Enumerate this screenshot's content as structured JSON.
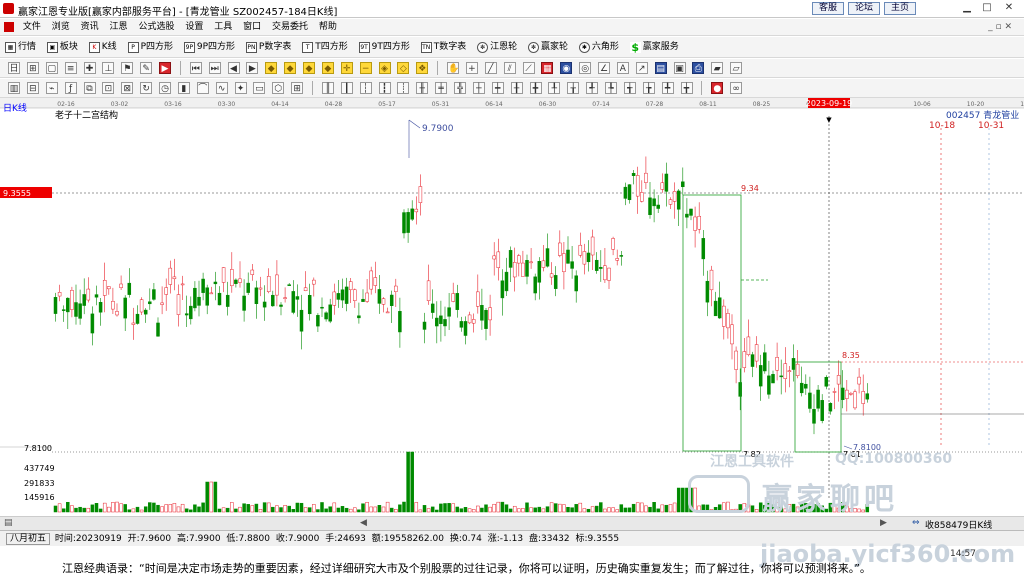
{
  "window": {
    "title": "赢家江恩专业版[赢家内部服务平台] - [青龙管业  SZ002457-184日K线]",
    "buttons": [
      "客服",
      "论坛",
      "主页"
    ]
  },
  "menu": [
    "文件",
    "浏览",
    "资讯",
    "江恩",
    "公式选股",
    "设置",
    "工具",
    "窗口",
    "交易委托",
    "帮助"
  ],
  "toolbar1": [
    {
      "label": "行情",
      "icon": "grid-icon"
    },
    {
      "label": "板块",
      "icon": "blocks-icon"
    },
    {
      "label": "K线",
      "icon": "candle-icon"
    },
    {
      "label": "P四方形",
      "icon": "P"
    },
    {
      "label": "9P四方形",
      "icon": "9P"
    },
    {
      "label": "P数字表",
      "icon": "PN"
    },
    {
      "label": "T四方形",
      "icon": "T"
    },
    {
      "label": "9T四方形",
      "icon": "9T"
    },
    {
      "label": "T数字表",
      "icon": "TN"
    },
    {
      "label": "江恩轮",
      "icon": "wheel-icon"
    },
    {
      "label": "赢家轮",
      "icon": "wheel-icon"
    },
    {
      "label": "六角形",
      "icon": "hexagon-icon"
    },
    {
      "label": "赢家服务",
      "icon": "dollar-icon"
    }
  ],
  "chart": {
    "period_label": "日K线",
    "indicator_label": "老子十二宫结构",
    "stock_label": "002457  青龙管业",
    "price_axis_label": "9.3555",
    "low_axis_label": "7.8100",
    "cursor_date_label": "2023-09-19",
    "date_ticks": [
      "02-16",
      "03-02",
      "03-16",
      "03-30",
      "04-14",
      "04-28",
      "05-17",
      "05-31",
      "06-14",
      "06-30",
      "07-14",
      "07-28",
      "08-11",
      "08-25",
      "09-08",
      "2023-09-19",
      "10-06",
      "10-20",
      "11-03"
    ],
    "high_label": "9.7900",
    "low_label": "7.8100",
    "box1_top_label": "9.34",
    "box1_bottom_label": "7.82",
    "box2_top_label": "8.35",
    "box2_bottom_label": "7.61",
    "future_date_labels": [
      "10-18",
      "10-31"
    ],
    "volume_axis_labels": [
      "437749",
      "291833",
      "145916"
    ],
    "colors": {
      "up": "#e8202a",
      "down": "#008a00",
      "box": "#22a02a",
      "grid": "#e0e0e0",
      "axis": "#4050a0"
    }
  },
  "chart_data": {
    "type": "candlestick",
    "title": "老子十二宫结构",
    "ylim": [
      7.61,
      9.79
    ],
    "reference_price": 9.3555,
    "high": 9.79,
    "low": 7.81,
    "volume_ticks": [
      437749,
      291833,
      145916
    ]
  },
  "watermarks": {
    "software": "江恩工具软件",
    "qq": "QQ:100800360",
    "brand": "赢家聊吧",
    "url": "jiaoba.yicf360.com"
  },
  "scroll": {
    "right_text": "收858479日K线"
  },
  "status": {
    "lunar": "八月初五",
    "time": "时间:20230919",
    "open": "开:7.9600",
    "high": "高:7.9900",
    "low": "低:7.8800",
    "close": "收:7.9000",
    "volume": "手:24693",
    "amount": "额:19558262.00",
    "turnover": "换:0.74",
    "change": "涨:-1.13",
    "tick": "盘:33432",
    "marker": "标:9.3555"
  },
  "footer": {
    "quote": "江恩经典语录：“时间是决定市场走势的重要因素，经过详细研究大市及个别股票的过往记录，你将可以证明，历史确实重复发生；而了解过往，你将可以预测将来。”。",
    "clock": "14:57"
  }
}
